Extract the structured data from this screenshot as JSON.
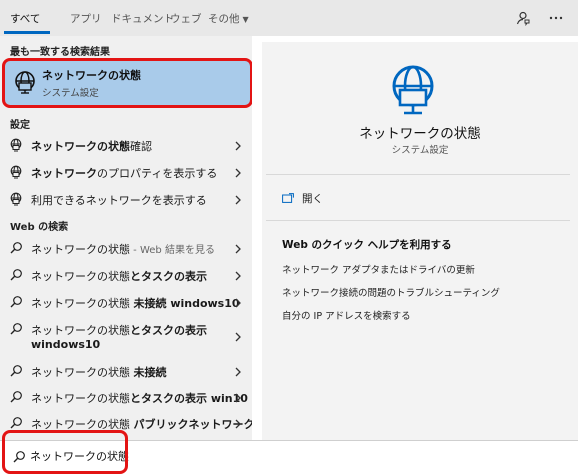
{
  "tabs": [
    {
      "label": "すべて"
    },
    {
      "label": "アプリ"
    },
    {
      "label": "ドキュメント"
    },
    {
      "label": "ウェブ"
    },
    {
      "label": "その他"
    }
  ],
  "sections": {
    "best_match": "最も一致する検索結果",
    "settings": "設定",
    "web": "Web の検索"
  },
  "best_match": {
    "title": "ネットワークの状態",
    "subtitle": "システム設定",
    "icon": "globe-monitor-icon"
  },
  "settings_items": [
    {
      "bold": "ネットワークの状態",
      "rest": "確認"
    },
    {
      "bold": "ネットワーク",
      "rest": "のプロパティを表示する"
    },
    {
      "bold": "",
      "rest": "利用できるネットワークを表示する"
    }
  ],
  "web_items": [
    {
      "prefix": "ネットワークの状態",
      "dim": " - Web 結果を見る",
      "suffix": ""
    },
    {
      "prefix": "ネットワークの状態",
      "suffix": "とタスクの表示"
    },
    {
      "prefix": "ネットワークの状態 ",
      "suffix": "未接続 windows10"
    },
    {
      "prefix": "ネットワークの状態",
      "suffix": "とタスクの表示",
      "line2": "windows10"
    },
    {
      "prefix": "ネットワークの状態 ",
      "suffix": "未接続"
    },
    {
      "prefix": "ネットワークの状態",
      "suffix": "とタスクの表示 win10"
    },
    {
      "prefix": "ネットワークの状態 ",
      "suffix": "パブリックネットワーク"
    }
  ],
  "preview": {
    "title": "ネットワークの状態",
    "subtitle": "システム設定",
    "open_label": "開く",
    "help_title": "Web のクイック ヘルプを利用する",
    "help_links": [
      "ネットワーク アダプタまたはドライバの更新",
      "ネットワーク接続の問題のトラブルシューティング",
      "自分の IP アドレスを検索する"
    ]
  },
  "search": {
    "value": "ネットワークの状態"
  },
  "colors": {
    "accent": "#0067c0",
    "highlight_border": "#e31414",
    "selected_bg": "#a9cbea"
  }
}
